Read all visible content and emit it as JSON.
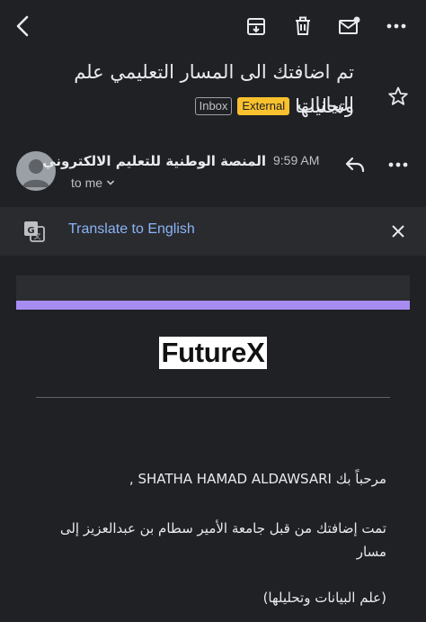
{
  "subject": {
    "line1": "تم اضافتك الى المسار التعليمي علم البيانات",
    "line2": "وتحليلها",
    "external_badge": "External",
    "inbox_badge": "Inbox"
  },
  "sender": {
    "name": "المنصة الوطنية للتعليم الالكتروني",
    "time": "9:59 AM",
    "recipient": "to me"
  },
  "translate": {
    "label": "Translate to English"
  },
  "email_body": {
    "logo": "FutureX",
    "greeting": "مرحباً بك SHATHA HAMAD ALDAWSARI ,",
    "paragraph": "تمت إضافتك من قبل جامعة الأمير سطام بن عبدالعزيز إلى مسار",
    "track": "(علم البيانات وتحليلها)"
  },
  "icons": {
    "back": "back-arrow-icon",
    "archive": "archive-icon",
    "delete": "trash-icon",
    "unread": "mark-unread-icon",
    "more": "more-horiz-icon",
    "star": "star-outline-icon",
    "reply": "reply-icon",
    "translate": "translate-icon",
    "close": "close-icon"
  },
  "colors": {
    "background": "#202124",
    "external_badge": "#f9c12e",
    "link": "#8ab4f8",
    "banner_purple": "#a68cf0"
  }
}
